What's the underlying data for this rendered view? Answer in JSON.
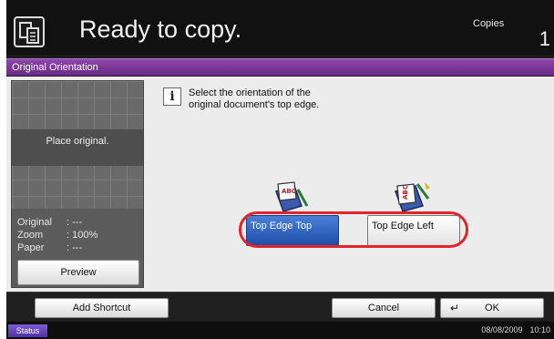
{
  "header": {
    "title": "Ready to copy.",
    "copies_label": "Copies",
    "copies_value": "1"
  },
  "dialog_title": "Original Orientation",
  "preview_panel": {
    "placeholder": "Place original.",
    "rows": [
      {
        "label": "Original",
        "value": ": ---"
      },
      {
        "label": "Zoom",
        "value": ": 100%"
      },
      {
        "label": "Paper",
        "value": ": ---"
      }
    ],
    "preview_label": "Preview"
  },
  "instruction": {
    "line1": "Select the orientation of the",
    "line2": "original document's top edge."
  },
  "options": [
    {
      "label": "Top Edge Top",
      "selected": true
    },
    {
      "label": "Top Edge Left",
      "selected": false
    }
  ],
  "bottom": {
    "shortcut_label": "Add Shortcut",
    "cancel_label": "Cancel",
    "ok_label": "OK"
  },
  "status": {
    "label": "Status",
    "date": "08/08/2009",
    "time": "10:10"
  },
  "colors": {
    "title_bar": "#7a3596",
    "selected": "#2f5fbf",
    "highlight_ring": "#e0262a"
  }
}
